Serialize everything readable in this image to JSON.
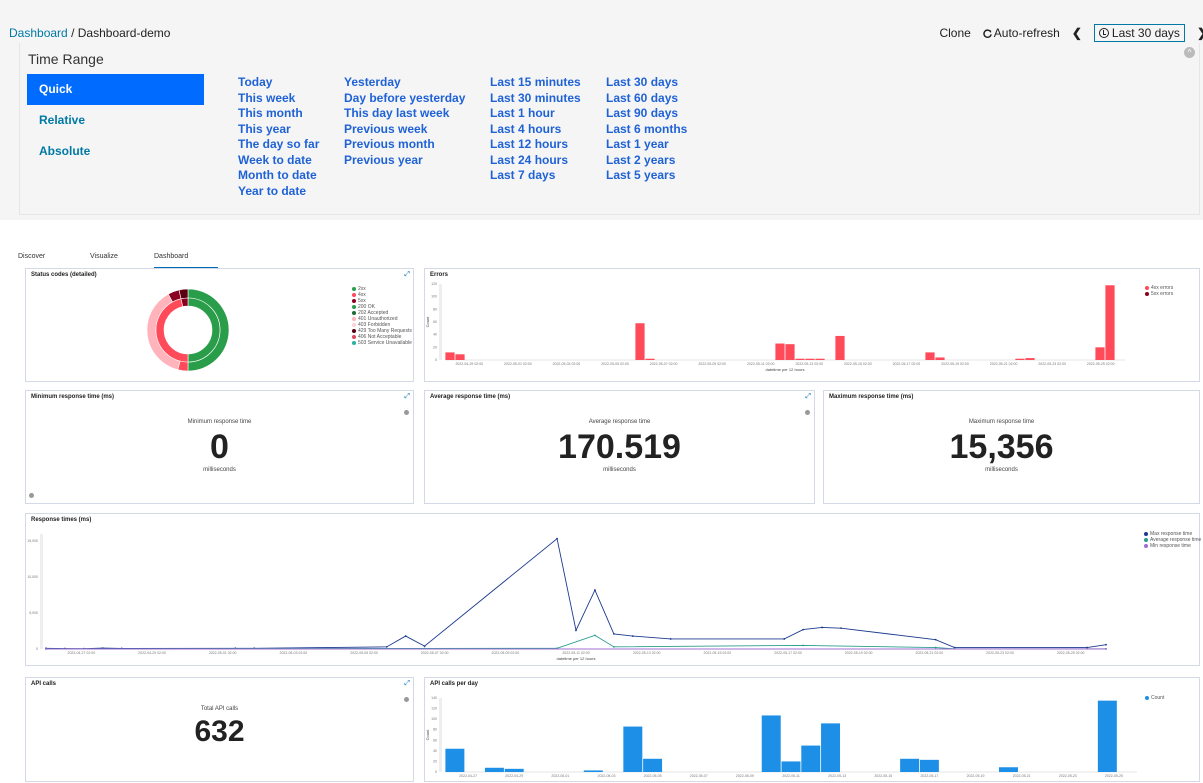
{
  "breadcrumb": {
    "root": "Dashboard",
    "separator": "/",
    "current": "Dashboard-demo"
  },
  "toolbar": {
    "clone": "Clone",
    "auto_refresh": "Auto-refresh",
    "time_label": "Last 30 days",
    "prev_icon": "chevron-left-icon",
    "next_icon": "chevron-right-icon"
  },
  "time_range": {
    "title": "Time Range",
    "modes": [
      "Quick",
      "Relative",
      "Absolute"
    ],
    "active_mode": "Quick",
    "columns": [
      [
        "Today",
        "This week",
        "This month",
        "This year",
        "The day so far",
        "Week to date",
        "Month to date",
        "Year to date"
      ],
      [
        "Yesterday",
        "Day before yesterday",
        "This day last week",
        "Previous week",
        "Previous month",
        "Previous year"
      ],
      [
        "Last 15 minutes",
        "Last 30 minutes",
        "Last 1 hour",
        "Last 4 hours",
        "Last 12 hours",
        "Last 24 hours",
        "Last 7 days"
      ],
      [
        "Last 30 days",
        "Last 60 days",
        "Last 90 days",
        "Last 6 months",
        "Last 1 year",
        "Last 2 years",
        "Last 5 years"
      ]
    ]
  },
  "nav_tabs": [
    "Discover",
    "Visualize",
    "Dashboard"
  ],
  "active_tab": "Dashboard",
  "colors": {
    "accent": "#006cff",
    "link": "#1f62d6",
    "ok": "#2a9d4a",
    "error": "#ff4a5a",
    "dark_red": "#8b0020",
    "blue_bar": "#1e8fe6",
    "navy": "#1c3b8f",
    "teal": "#2a9d8f",
    "purple": "#a06cd5"
  },
  "status_codes": {
    "title": "Status codes (detailed)",
    "legend": [
      {
        "label": "2xx",
        "color": "#2a9d4a"
      },
      {
        "label": "4xx",
        "color": "#ff4a5a"
      },
      {
        "label": "5xx",
        "color": "#8b0020"
      },
      {
        "label": "200 OK",
        "color": "#2a9d4a"
      },
      {
        "label": "202 Accepted",
        "color": "#1e6b33"
      },
      {
        "label": "401 Unauthorized",
        "color": "#ffb3ba"
      },
      {
        "label": "403 Forbidden",
        "color": "#ffd1d6"
      },
      {
        "label": "429 Too Many Requests",
        "color": "#5a0010"
      },
      {
        "label": "406 Not Acceptable",
        "color": "#e0485a"
      },
      {
        "label": "503 Service Unavailable",
        "color": "#2ab0a0"
      }
    ]
  },
  "errors_chart": {
    "title": "Errors",
    "chart_data": {
      "type": "bar",
      "xlabel": "datetime per 12 hours",
      "ylabel": "Count",
      "ylim": [
        0,
        120
      ],
      "yticks": [
        0,
        20,
        40,
        60,
        80,
        100,
        120
      ],
      "xticks": [
        "2022-04-29 02:00",
        "2022-05-01 02:00",
        "2022-05-03 02:00",
        "2022-05-05 02:00",
        "2022-05-07 02:00",
        "2022-05-09 02:00",
        "2022-05-11 02:00",
        "2022-05-13 02:00",
        "2022-05-15 02:00",
        "2022-05-17 02:00",
        "2022-05-19 02:00",
        "2022-05-21 02:00",
        "2022-05-23 02:00",
        "2022-05-25 02:00"
      ],
      "series": [
        {
          "name": "4xx errors",
          "color": "#ff4a5a",
          "values": [
            12,
            9,
            0,
            0,
            0,
            0,
            0,
            0,
            0,
            0,
            0,
            0,
            0,
            0,
            0,
            0,
            0,
            0,
            0,
            58,
            2,
            0,
            0,
            0,
            0,
            0,
            0,
            0,
            0,
            0,
            0,
            0,
            0,
            26,
            25,
            2,
            2,
            2,
            0,
            38,
            0,
            0,
            0,
            0,
            0,
            0,
            0,
            0,
            12,
            4,
            0,
            0,
            0,
            0,
            0,
            0,
            0,
            2,
            3,
            0,
            0,
            0,
            0,
            0,
            0,
            20,
            118,
            0
          ]
        },
        {
          "name": "5xx errors",
          "color": "#8b0020",
          "values": [
            0
          ]
        }
      ]
    }
  },
  "min_response": {
    "title": "Minimum response time (ms)",
    "label": "Minimum response time",
    "value": "0",
    "unit": "milliseconds"
  },
  "avg_response": {
    "title": "Average response time (ms)",
    "label": "Average response time",
    "value": "170.519",
    "unit": "milliseconds"
  },
  "max_response": {
    "title": "Maximum response time (ms)",
    "label": "Maximum response time",
    "value": "15,356",
    "unit": "milliseconds"
  },
  "response_times": {
    "title": "Response times (ms)",
    "chart_data": {
      "type": "line",
      "xlabel": "datetime per 12 hours",
      "ylim": [
        0,
        16000
      ],
      "yticks": [
        "0",
        "5,000",
        "10,000",
        "15,000"
      ],
      "ytick_values": [
        0,
        5000,
        10000,
        15000
      ],
      "xticks": [
        "2022-04-27 02:00",
        "2022-04-29 02:00",
        "2022-05-01 02:00",
        "2022-05-03 02:00",
        "2022-05-05 02:00",
        "2022-05-07 02:00",
        "2022-05-09 02:00",
        "2022-05-11 02:00",
        "2022-05-13 02:00",
        "2022-05-15 02:00",
        "2022-05-17 02:00",
        "2022-05-19 02:00",
        "2022-05-21 02:00",
        "2022-05-23 02:00",
        "2022-05-25 02:00"
      ],
      "series": [
        {
          "name": "Max response time",
          "color": "#1c3b8f",
          "points": [
            [
              0,
              100
            ],
            [
              1,
              60
            ],
            [
              2,
              50
            ],
            [
              3,
              120
            ],
            [
              4,
              80
            ],
            [
              10,
              100
            ],
            [
              11,
              100
            ],
            [
              18,
              300
            ],
            [
              19,
              1800
            ],
            [
              20,
              400
            ],
            [
              27,
              15356
            ],
            [
              28,
              2600
            ],
            [
              29,
              8200
            ],
            [
              30,
              2100
            ],
            [
              31,
              1800
            ],
            [
              33,
              1400
            ],
            [
              39,
              1400
            ],
            [
              40,
              2700
            ],
            [
              41,
              3000
            ],
            [
              42,
              2900
            ],
            [
              47,
              1300
            ],
            [
              48,
              200
            ],
            [
              55,
              200
            ],
            [
              56,
              600
            ]
          ]
        },
        {
          "name": "Average response time",
          "color": "#2a9d8f",
          "points": [
            [
              0,
              20
            ],
            [
              20,
              80
            ],
            [
              27,
              100
            ],
            [
              29,
              1900
            ],
            [
              30,
              300
            ],
            [
              40,
              500
            ],
            [
              47,
              200
            ],
            [
              48,
              30
            ],
            [
              56,
              30
            ]
          ]
        },
        {
          "name": "Min response time",
          "color": "#a06cd5",
          "points": [
            [
              0,
              0
            ],
            [
              56,
              0
            ]
          ]
        }
      ]
    }
  },
  "api_calls": {
    "title": "API calls",
    "label": "Total API calls",
    "value": "632"
  },
  "api_calls_per_day": {
    "title": "API calls per day",
    "chart_data": {
      "type": "bar",
      "ylabel": "Count",
      "ylim": [
        0,
        140
      ],
      "yticks": [
        0,
        20,
        40,
        60,
        80,
        100,
        120,
        140
      ],
      "xticks": [
        "2022-04-27",
        "2022-04-29",
        "2022-05-01",
        "2022-05-03",
        "2022-05-05",
        "2022-05-07",
        "2022-05-09",
        "2022-05-11",
        "2022-05-13",
        "2022-05-15",
        "2022-05-17",
        "2022-05-19",
        "2022-05-21",
        "2022-05-23",
        "2022-05-25"
      ],
      "series": [
        {
          "name": "Count",
          "color": "#1e8fe6",
          "values": [
            44,
            0,
            8,
            6,
            0,
            0,
            0,
            3,
            0,
            86,
            25,
            0,
            0,
            0,
            0,
            0,
            107,
            20,
            50,
            92,
            0,
            0,
            0,
            25,
            23,
            0,
            0,
            0,
            9,
            0,
            0,
            0,
            0,
            135,
            0
          ]
        }
      ]
    }
  }
}
